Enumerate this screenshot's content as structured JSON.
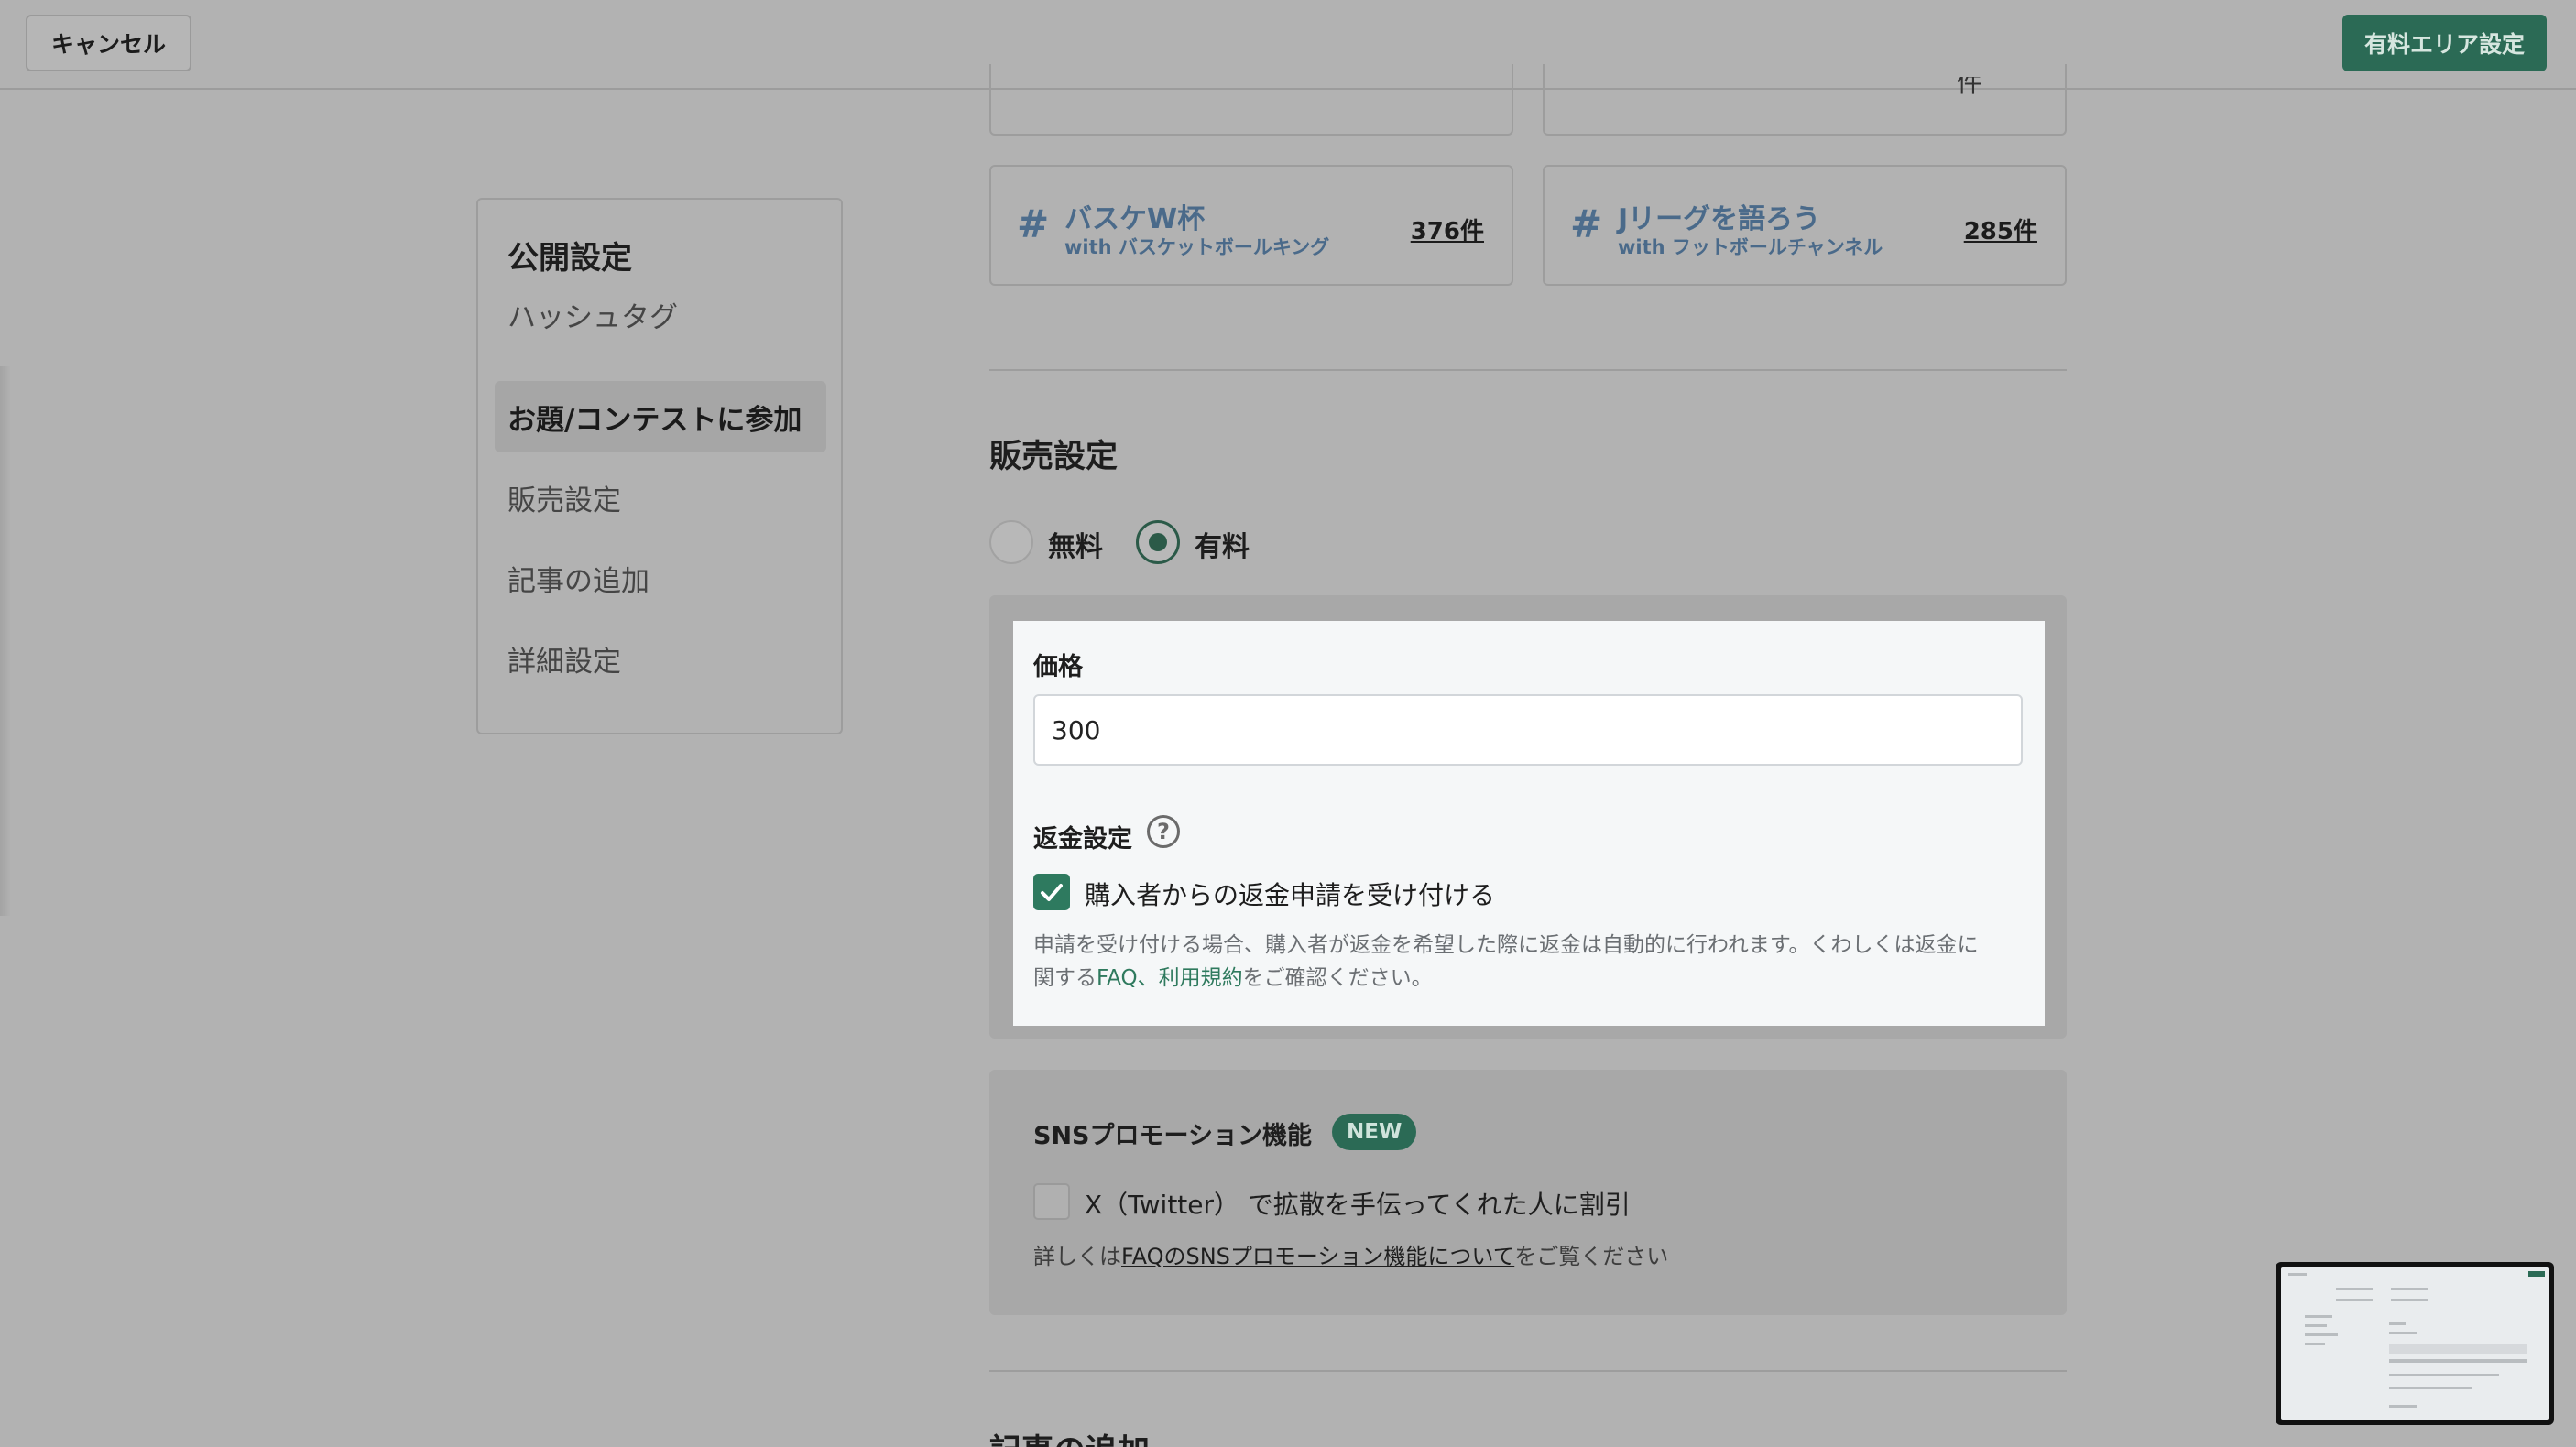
{
  "topbar": {
    "cancel_label": "キャンセル",
    "paid_area_label": "有料エリア設定"
  },
  "toc": {
    "title": "公開設定",
    "items": [
      {
        "label": "ハッシュタグ"
      },
      {
        "label": "お題/コンテストに参加",
        "active": true
      },
      {
        "label": "販売設定"
      },
      {
        "label": "記事の追加"
      },
      {
        "label": "詳細設定"
      }
    ]
  },
  "partial_cards": {
    "right_glyph": "件"
  },
  "hashtags": [
    {
      "hash": "#",
      "name": "バスケW杯",
      "with": "with バスケットボールキング",
      "count": "376件"
    },
    {
      "hash": "#",
      "name": "Jリーグを語ろう",
      "with": "with フットボールチャンネル",
      "count": "285件"
    }
  ],
  "sales": {
    "title": "販売設定",
    "option_free": "無料",
    "option_paid": "有料",
    "selected": "有料",
    "price_label": "価格",
    "price_value": "300",
    "refund_label": "返金設定",
    "help_icon": "?",
    "refund_checkbox_label": "購入者からの返金申請を受け付ける",
    "refund_checked": true,
    "note_line1": "申請を受け付ける場合、購入者が返金を希望した際に返金は自動的に行われます。くわしくは返金に",
    "note_line2_prefix": "関する",
    "note_link_faq": "FAQ",
    "note_sep": "、",
    "note_link_terms": "利用規約",
    "note_line2_suffix": "をご確認ください。"
  },
  "sns": {
    "title": "SNSプロモーション機能",
    "badge": "NEW",
    "checkbox_label": "X（Twitter） で拡散を手伝ってくれた人に割引",
    "checked": false,
    "note_prefix": "詳しくは",
    "note_link": "FAQのSNSプロモーション機能について",
    "note_suffix": "をご覧ください"
  },
  "next_section_title": "記事の追加",
  "colors": {
    "accent": "#2b6a55",
    "link": "#2f7a5e",
    "hashtag": "#4a6a8a"
  }
}
